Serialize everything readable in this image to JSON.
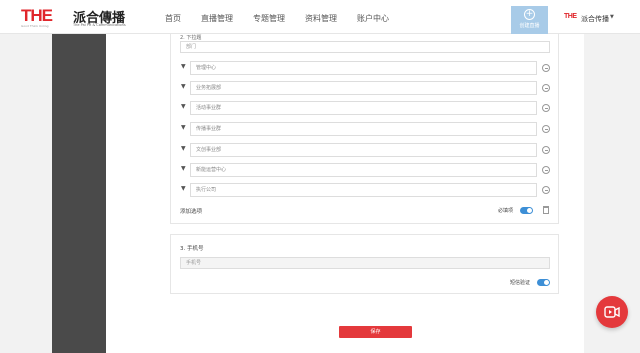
{
  "header": {
    "logo_mark": "THE",
    "logo_mark_sub": "Good Think Unling",
    "logo_name": "派合傳播",
    "logo_en": "The Pai PR & Communications",
    "nav": [
      "首页",
      "直播管理",
      "专题管理",
      "资料管理",
      "账户中心"
    ],
    "create_button_label": "创建直播",
    "brand_mini": "THE",
    "brand_name": "派合传播"
  },
  "form": {
    "question2": {
      "title": "2. 下拉题",
      "department_placeholder": "部门",
      "options": [
        "管理中心",
        "业务拓展部",
        "活动事业群",
        "传播事业群",
        "文创事业部",
        "新能运营中心",
        "执行公司"
      ],
      "add_option_label": "添加选项",
      "required_label": "必填项",
      "required": true
    },
    "question3": {
      "title": "3. 手机号",
      "phone_placeholder": "手机号",
      "sms_verify_label": "短信验证",
      "sms_verify": true
    },
    "save_label": "保存"
  },
  "colors": {
    "accent_red": "#e4393c",
    "toggle_blue": "#3d8fd6",
    "sidebar": "#4a4a4a"
  },
  "icons": {
    "fab": "video-icon"
  }
}
